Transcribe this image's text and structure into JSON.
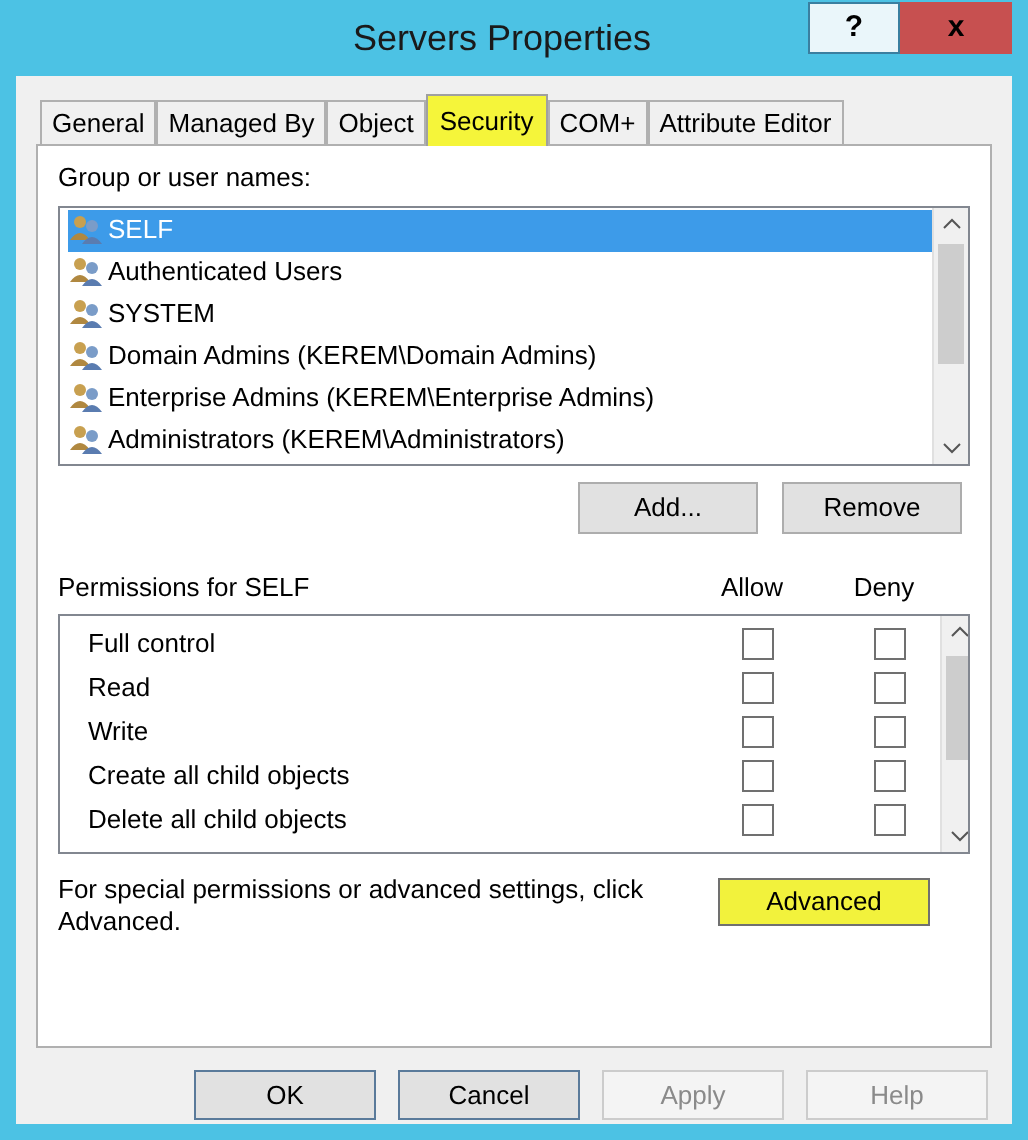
{
  "window": {
    "title": "Servers Properties",
    "help": "?",
    "close": "x"
  },
  "tabs": [
    {
      "label": "General",
      "selected": false
    },
    {
      "label": "Managed By",
      "selected": false
    },
    {
      "label": "Object",
      "selected": false
    },
    {
      "label": "Security",
      "selected": true
    },
    {
      "label": "COM+",
      "selected": false
    },
    {
      "label": "Attribute Editor",
      "selected": false
    }
  ],
  "users": {
    "label": "Group or user names:",
    "items": [
      {
        "name": "SELF",
        "selected": true
      },
      {
        "name": "Authenticated Users",
        "selected": false
      },
      {
        "name": "SYSTEM",
        "selected": false
      },
      {
        "name": "Domain Admins (KEREM\\Domain Admins)",
        "selected": false
      },
      {
        "name": "Enterprise Admins (KEREM\\Enterprise Admins)",
        "selected": false
      },
      {
        "name": "Administrators (KEREM\\Administrators)",
        "selected": false
      }
    ],
    "buttons": [
      "Add...",
      "Remove"
    ]
  },
  "permissions": {
    "label": "Permissions for SELF",
    "allow_header": "Allow",
    "deny_header": "Deny",
    "rows": [
      {
        "name": "Full control",
        "allow": false,
        "deny": false
      },
      {
        "name": "Read",
        "allow": false,
        "deny": false
      },
      {
        "name": "Write",
        "allow": false,
        "deny": false
      },
      {
        "name": "Create all child objects",
        "allow": false,
        "deny": false
      },
      {
        "name": "Delete all child objects",
        "allow": false,
        "deny": false
      }
    ]
  },
  "advanced": {
    "text": "For special permissions or advanced settings, click Advanced.",
    "button": "Advanced",
    "highlighted": true
  },
  "footer_buttons": [
    {
      "label": "OK",
      "disabled": false
    },
    {
      "label": "Cancel",
      "disabled": false
    },
    {
      "label": "Apply",
      "disabled": true
    },
    {
      "label": "Help",
      "disabled": true
    }
  ]
}
